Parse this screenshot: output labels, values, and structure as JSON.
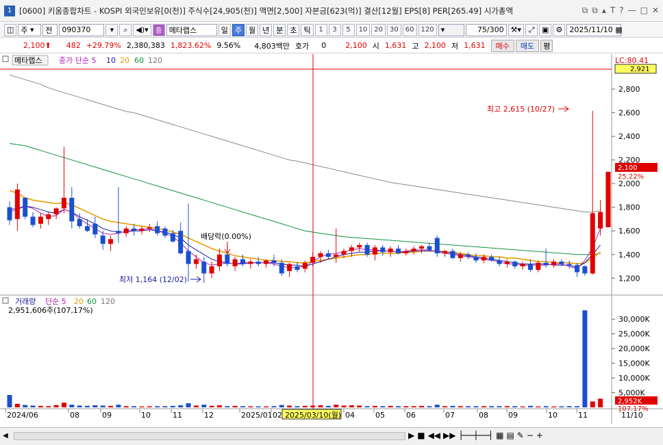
{
  "window": {
    "number": "1",
    "title": "[0600] 키움종합차트 - KOSPI 외국인보유[0(천)] 주식수[24,905(천)] 액면[2,500] 자본금[623(억)] 결산[12월] EPS[8] PER[265.49] 시가총액",
    "buttons": [
      "⧉",
      "⧉",
      "▴",
      "T",
      "?",
      "—",
      "□",
      "✕"
    ]
  },
  "toolbar": {
    "type": "주",
    "sel2": "전",
    "code": "090370",
    "search_icon": "magnifier-icon",
    "name": "메타랩스",
    "period_buttons": [
      "일",
      "주",
      "월",
      "년",
      "분",
      "초",
      "틱"
    ],
    "active_period": "주",
    "numbers": [
      "1",
      "3",
      "5",
      "10",
      "20",
      "30",
      "60",
      "120"
    ],
    "count": "75",
    "count_total": "/300",
    "date": "2025/11/10"
  },
  "quote": {
    "price": "2,100",
    "change": "482",
    "rate": "+29.79%",
    "volume": "2,380,383",
    "vol_rate": "1,823.62%",
    "turnover": "9.56%",
    "amount": "4,803백만",
    "hoga_label": "호가",
    "hoga_val": "0",
    "current": "2,100",
    "open_label": "시",
    "open": "1,631",
    "high_label": "고",
    "high": "2,100",
    "low_label": "저",
    "low": "1,631",
    "buy": "매수",
    "sell": "매도",
    "eval": "평"
  },
  "chart_data": {
    "type": "candlestick",
    "title": "메타랩스",
    "price_legend": [
      "종가 단순 5",
      "10",
      "20",
      "60",
      "120"
    ],
    "volume_legend": [
      "거래량",
      "단순 5",
      "20",
      "60",
      "120"
    ],
    "volume_info": "2,951,606주(107,17%)",
    "price_axis": [
      2800,
      2600,
      2400,
      2200,
      2000,
      1800,
      1600,
      1400,
      1200
    ],
    "price_range": [
      1080,
      2980
    ],
    "volume_axis": [
      "30,000K",
      "25,000K",
      "20,000K",
      "15,000K",
      "10,000K",
      "5,000K"
    ],
    "volume_range": [
      0,
      34000
    ],
    "top_label": "LC:80.41",
    "top_value": "2,921",
    "current_label": "2,100",
    "current_pct": "25.22%",
    "vol_current": "2,952K",
    "vol_pct": "107.17%",
    "high_annotation": "최고 2,615 (10/27)",
    "low_annotation": "최저 1,164 (12/02)",
    "dividend_annotation": "배당락(0.00%)",
    "x_labels": [
      "2024/06",
      "08",
      "09",
      "10",
      "11",
      "12",
      "2025/01",
      "02",
      "2025/03/10(월)",
      "04",
      "05",
      "06",
      "07",
      "08",
      "09",
      "10",
      "11",
      "11/10"
    ],
    "candles": [
      {
        "o": 1800,
        "h": 1850,
        "l": 1650,
        "c": 1690
      },
      {
        "o": 1700,
        "h": 2000,
        "l": 1600,
        "c": 1950
      },
      {
        "o": 1880,
        "h": 1880,
        "l": 1700,
        "c": 1720
      },
      {
        "o": 1720,
        "h": 1760,
        "l": 1630,
        "c": 1650
      },
      {
        "o": 1660,
        "h": 1750,
        "l": 1620,
        "c": 1720
      },
      {
        "o": 1700,
        "h": 1760,
        "l": 1650,
        "c": 1740
      },
      {
        "o": 1740,
        "h": 1800,
        "l": 1700,
        "c": 1790
      },
      {
        "o": 1790,
        "h": 2310,
        "l": 1750,
        "c": 1880
      },
      {
        "o": 1880,
        "h": 1970,
        "l": 1620,
        "c": 1680
      },
      {
        "o": 1700,
        "h": 1750,
        "l": 1620,
        "c": 1640
      },
      {
        "o": 1640,
        "h": 1700,
        "l": 1590,
        "c": 1600
      },
      {
        "o": 1660,
        "h": 1720,
        "l": 1540,
        "c": 1570
      },
      {
        "o": 1560,
        "h": 1600,
        "l": 1440,
        "c": 1490
      },
      {
        "o": 1490,
        "h": 1560,
        "l": 1430,
        "c": 1530
      },
      {
        "o": 1600,
        "h": 1970,
        "l": 1500,
        "c": 1580
      },
      {
        "o": 1580,
        "h": 1640,
        "l": 1550,
        "c": 1620
      },
      {
        "o": 1620,
        "h": 1660,
        "l": 1560,
        "c": 1600
      },
      {
        "o": 1600,
        "h": 1640,
        "l": 1570,
        "c": 1620
      },
      {
        "o": 1620,
        "h": 1660,
        "l": 1590,
        "c": 1630
      },
      {
        "o": 1640,
        "h": 1680,
        "l": 1560,
        "c": 1580
      },
      {
        "o": 1620,
        "h": 1640,
        "l": 1540,
        "c": 1560
      },
      {
        "o": 1580,
        "h": 1610,
        "l": 1500,
        "c": 1510
      },
      {
        "o": 1600,
        "h": 1670,
        "l": 1400,
        "c": 1410
      },
      {
        "o": 1430,
        "h": 1830,
        "l": 1170,
        "c": 1320
      },
      {
        "o": 1320,
        "h": 1400,
        "l": 1280,
        "c": 1360
      },
      {
        "o": 1340,
        "h": 1380,
        "l": 1160,
        "c": 1240
      },
      {
        "o": 1240,
        "h": 1340,
        "l": 1200,
        "c": 1300
      },
      {
        "o": 1300,
        "h": 1450,
        "l": 1260,
        "c": 1400
      },
      {
        "o": 1400,
        "h": 1480,
        "l": 1300,
        "c": 1320
      },
      {
        "o": 1300,
        "h": 1380,
        "l": 1260,
        "c": 1360
      },
      {
        "o": 1360,
        "h": 1400,
        "l": 1300,
        "c": 1320
      },
      {
        "o": 1320,
        "h": 1360,
        "l": 1280,
        "c": 1340
      },
      {
        "o": 1340,
        "h": 1380,
        "l": 1300,
        "c": 1320
      },
      {
        "o": 1320,
        "h": 1360,
        "l": 1290,
        "c": 1350
      },
      {
        "o": 1350,
        "h": 1400,
        "l": 1300,
        "c": 1330
      },
      {
        "o": 1330,
        "h": 1360,
        "l": 1220,
        "c": 1240
      },
      {
        "o": 1260,
        "h": 1330,
        "l": 1210,
        "c": 1320
      },
      {
        "o": 1300,
        "h": 1340,
        "l": 1250,
        "c": 1270
      },
      {
        "o": 1280,
        "h": 1350,
        "l": 1250,
        "c": 1330
      },
      {
        "o": 1330,
        "h": 1420,
        "l": 1300,
        "c": 1380
      },
      {
        "o": 1380,
        "h": 1430,
        "l": 1330,
        "c": 1410
      },
      {
        "o": 1410,
        "h": 1440,
        "l": 1360,
        "c": 1380
      },
      {
        "o": 1380,
        "h": 1620,
        "l": 1330,
        "c": 1400
      },
      {
        "o": 1400,
        "h": 1450,
        "l": 1370,
        "c": 1430
      },
      {
        "o": 1430,
        "h": 1480,
        "l": 1380,
        "c": 1460
      },
      {
        "o": 1460,
        "h": 1500,
        "l": 1420,
        "c": 1480
      },
      {
        "o": 1480,
        "h": 1500,
        "l": 1380,
        "c": 1400
      },
      {
        "o": 1400,
        "h": 1480,
        "l": 1350,
        "c": 1460
      },
      {
        "o": 1460,
        "h": 1480,
        "l": 1390,
        "c": 1420
      },
      {
        "o": 1420,
        "h": 1470,
        "l": 1380,
        "c": 1450
      },
      {
        "o": 1450,
        "h": 1480,
        "l": 1400,
        "c": 1410
      },
      {
        "o": 1410,
        "h": 1450,
        "l": 1390,
        "c": 1430
      },
      {
        "o": 1430,
        "h": 1470,
        "l": 1400,
        "c": 1450
      },
      {
        "o": 1450,
        "h": 1480,
        "l": 1410,
        "c": 1470
      },
      {
        "o": 1470,
        "h": 1500,
        "l": 1430,
        "c": 1440
      },
      {
        "o": 1540,
        "h": 1560,
        "l": 1380,
        "c": 1410
      },
      {
        "o": 1410,
        "h": 1440,
        "l": 1380,
        "c": 1430
      },
      {
        "o": 1430,
        "h": 1450,
        "l": 1360,
        "c": 1370
      },
      {
        "o": 1370,
        "h": 1420,
        "l": 1340,
        "c": 1400
      },
      {
        "o": 1400,
        "h": 1420,
        "l": 1360,
        "c": 1380
      },
      {
        "o": 1380,
        "h": 1410,
        "l": 1330,
        "c": 1350
      },
      {
        "o": 1350,
        "h": 1400,
        "l": 1330,
        "c": 1380
      },
      {
        "o": 1380,
        "h": 1400,
        "l": 1340,
        "c": 1350
      },
      {
        "o": 1350,
        "h": 1380,
        "l": 1300,
        "c": 1320
      },
      {
        "o": 1320,
        "h": 1360,
        "l": 1290,
        "c": 1340
      },
      {
        "o": 1340,
        "h": 1350,
        "l": 1280,
        "c": 1300
      },
      {
        "o": 1300,
        "h": 1340,
        "l": 1270,
        "c": 1320
      },
      {
        "o": 1320,
        "h": 1360,
        "l": 1250,
        "c": 1270
      },
      {
        "o": 1270,
        "h": 1350,
        "l": 1250,
        "c": 1330
      },
      {
        "o": 1330,
        "h": 1450,
        "l": 1290,
        "c": 1310
      },
      {
        "o": 1310,
        "h": 1360,
        "l": 1290,
        "c": 1340
      },
      {
        "o": 1340,
        "h": 1360,
        "l": 1300,
        "c": 1320
      },
      {
        "o": 1320,
        "h": 1350,
        "l": 1280,
        "c": 1310
      },
      {
        "o": 1310,
        "h": 1330,
        "l": 1210,
        "c": 1250
      },
      {
        "o": 1300,
        "h": 1310,
        "l": 1220,
        "c": 1240
      },
      {
        "o": 1240,
        "h": 2615,
        "l": 1230,
        "c": 1750
      },
      {
        "o": 1620,
        "h": 1860,
        "l": 1560,
        "c": 1760
      },
      {
        "o": 1631,
        "h": 2100,
        "l": 1631,
        "c": 2100
      }
    ],
    "volumes": [
      4200,
      1200,
      800,
      600,
      500,
      400,
      800,
      1600,
      900,
      600,
      500,
      700,
      600,
      500,
      900,
      400,
      400,
      300,
      350,
      400,
      400,
      500,
      700,
      1400,
      600,
      900,
      500,
      700,
      400,
      500,
      400,
      350,
      350,
      300,
      400,
      800,
      600,
      400,
      500,
      600,
      700,
      500,
      900,
      600,
      700,
      600,
      400,
      500,
      400,
      500,
      400,
      400,
      400,
      500,
      400,
      900,
      400,
      500,
      400,
      400,
      400,
      400,
      400,
      400,
      400,
      400,
      300,
      500,
      300,
      400,
      300,
      350,
      400,
      400,
      33000,
      2000,
      2952
    ],
    "ma_120": [
      2920,
      2900,
      2880,
      2860,
      2840,
      2810,
      2790,
      2770,
      2750,
      2730,
      2710,
      2690,
      2670,
      2650,
      2630,
      2610,
      2600,
      2580,
      2560,
      2540,
      2520,
      2500,
      2480,
      2460,
      2440,
      2420,
      2400,
      2380,
      2360,
      2340,
      2320,
      2300,
      2280,
      2260,
      2240,
      2220,
      2200,
      2190,
      2175,
      2160,
      2145,
      2130,
      2115,
      2100,
      2085,
      2070,
      2055,
      2040,
      2025,
      2010,
      2000,
      1990,
      1980,
      1970,
      1960,
      1950,
      1940,
      1930,
      1920,
      1910,
      1900,
      1890,
      1880,
      1870,
      1860,
      1850,
      1840,
      1830,
      1820,
      1810,
      1800,
      1790,
      1780,
      1770,
      1760,
      1760,
      1770
    ],
    "ma_60": [
      2340,
      2330,
      2320,
      2300,
      2280,
      2260,
      2240,
      2220,
      2200,
      2180,
      2160,
      2140,
      2120,
      2100,
      2080,
      2060,
      2040,
      2020,
      2000,
      1980,
      1960,
      1940,
      1920,
      1900,
      1880,
      1860,
      1840,
      1820,
      1800,
      1780,
      1760,
      1740,
      1720,
      1700,
      1680,
      1660,
      1640,
      1620,
      1600,
      1590,
      1580,
      1570,
      1560,
      1550,
      1545,
      1540,
      1535,
      1530,
      1525,
      1520,
      1515,
      1510,
      1505,
      1500,
      1495,
      1490,
      1485,
      1480,
      1475,
      1470,
      1465,
      1460,
      1455,
      1450,
      1445,
      1440,
      1435,
      1430,
      1425,
      1420,
      1415,
      1410,
      1405,
      1400,
      1400,
      1400,
      1410
    ],
    "ma_20": [
      1940,
      1920,
      1880,
      1860,
      1850,
      1840,
      1830,
      1840,
      1820,
      1790,
      1760,
      1730,
      1700,
      1680,
      1670,
      1660,
      1650,
      1640,
      1630,
      1620,
      1610,
      1590,
      1570,
      1540,
      1510,
      1480,
      1450,
      1430,
      1410,
      1390,
      1380,
      1370,
      1360,
      1350,
      1350,
      1340,
      1340,
      1330,
      1330,
      1340,
      1350,
      1360,
      1370,
      1380,
      1390,
      1400,
      1400,
      1410,
      1410,
      1410,
      1410,
      1420,
      1420,
      1430,
      1430,
      1430,
      1420,
      1420,
      1410,
      1400,
      1390,
      1390,
      1380,
      1380,
      1370,
      1370,
      1360,
      1350,
      1340,
      1340,
      1330,
      1330,
      1330,
      1320,
      1330,
      1370,
      1420
    ],
    "ma_10": [
      1780,
      1790,
      1810,
      1800,
      1780,
      1760,
      1750,
      1780,
      1760,
      1720,
      1690,
      1660,
      1620,
      1600,
      1590,
      1590,
      1600,
      1600,
      1610,
      1600,
      1590,
      1570,
      1540,
      1480,
      1440,
      1400,
      1360,
      1340,
      1330,
      1320,
      1320,
      1330,
      1330,
      1330,
      1330,
      1320,
      1310,
      1310,
      1300,
      1320,
      1340,
      1360,
      1380,
      1400,
      1410,
      1420,
      1420,
      1430,
      1430,
      1430,
      1420,
      1420,
      1430,
      1430,
      1430,
      1430,
      1420,
      1410,
      1400,
      1390,
      1380,
      1370,
      1360,
      1350,
      1340,
      1330,
      1320,
      1320,
      1320,
      1320,
      1310,
      1310,
      1310,
      1290,
      1330,
      1400,
      1480
    ],
    "ma_5": [
      1760,
      1780,
      1810,
      1790,
      1750,
      1720,
      1730,
      1780,
      1760,
      1700,
      1660,
      1620,
      1580,
      1570,
      1580,
      1600,
      1610,
      1610,
      1620,
      1600,
      1580,
      1550,
      1500,
      1430,
      1380,
      1330,
      1310,
      1320,
      1330,
      1320,
      1330,
      1330,
      1330,
      1330,
      1320,
      1300,
      1290,
      1290,
      1300,
      1340,
      1380,
      1400,
      1410,
      1420,
      1440,
      1450,
      1440,
      1440,
      1430,
      1430,
      1420,
      1430,
      1440,
      1440,
      1440,
      1420,
      1410,
      1400,
      1390,
      1380,
      1370,
      1360,
      1350,
      1340,
      1320,
      1320,
      1310,
      1310,
      1310,
      1310,
      1320,
      1320,
      1300,
      1280,
      1350,
      1460,
      1620
    ]
  },
  "scrollbar": {
    "controls": [
      "▶",
      "■",
      "◀◀",
      "▶▶"
    ]
  }
}
